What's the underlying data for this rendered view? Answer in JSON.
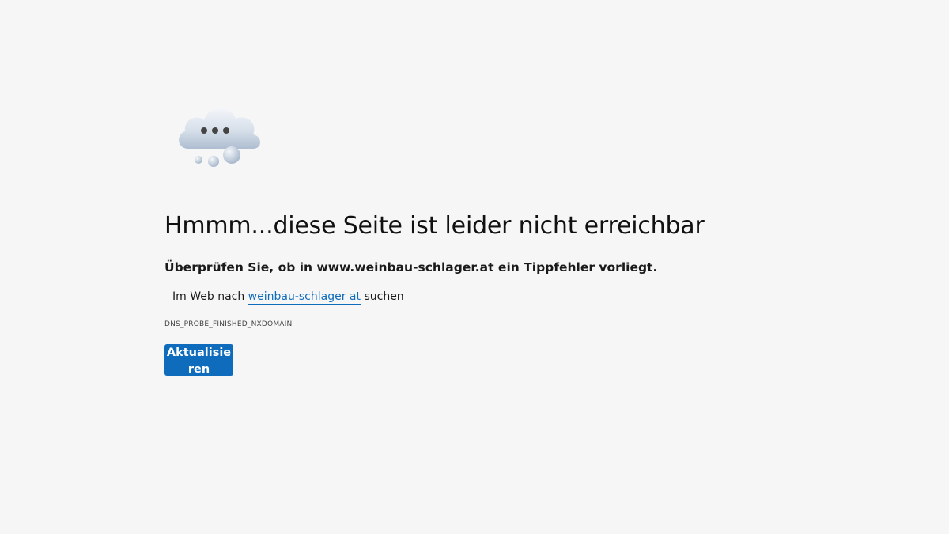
{
  "error_page": {
    "illustration_icon": "cloud-thinking-icon",
    "title": "Hmmm...diese Seite ist leider nicht erreichbar",
    "subtitle": "Überprüfen Sie, ob in www.weinbau-schlager.at ein Tippfehler vorliegt.",
    "search_prefix": "Im Web nach",
    "search_link": "weinbau-schlager at",
    "search_suffix": "suchen",
    "error_code": "DNS_PROBE_FINISHED_NXDOMAIN",
    "reload_label": "Aktualisieren"
  },
  "colors": {
    "background": "#f6f6f6",
    "accent": "#0f6cbd",
    "text": "#111111"
  }
}
